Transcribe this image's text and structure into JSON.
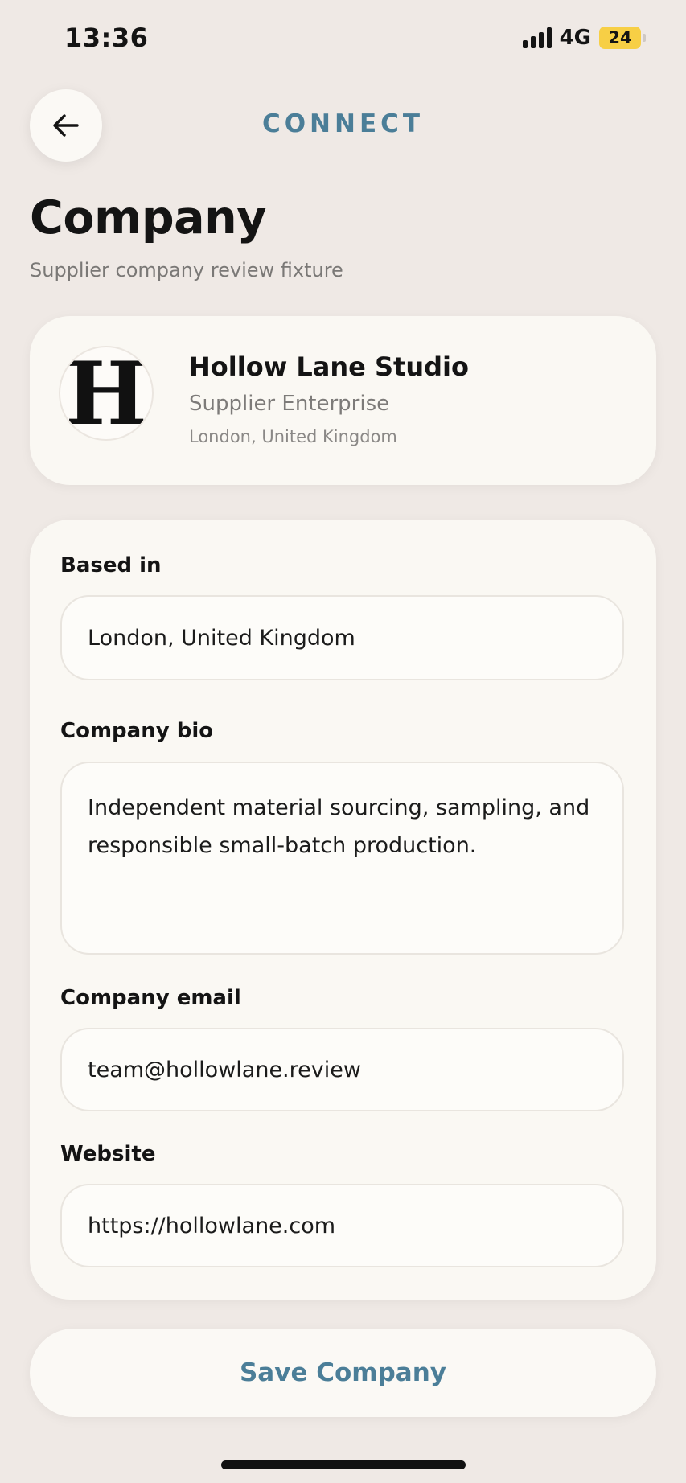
{
  "status_bar": {
    "time": "13:36",
    "network": "4G",
    "battery": "24",
    "battery_color": "#f7cf45"
  },
  "header": {
    "back_icon": "arrow-left-icon",
    "brand": "CONNECT",
    "brand_color": "#4b7e98"
  },
  "page": {
    "title": "Company",
    "subtitle": "Supplier company review fixture"
  },
  "company": {
    "logo_letter": "H",
    "name": "Hollow Lane Studio",
    "type": "Supplier Enterprise",
    "location": "London, United Kingdom"
  },
  "form": {
    "based_in": {
      "label": "Based in",
      "value": "London, United Kingdom"
    },
    "bio": {
      "label": "Company bio",
      "value": "Independent material sourcing, sampling, and responsible small-batch production."
    },
    "email": {
      "label": "Company email",
      "value": "team@hollowlane.review"
    },
    "website": {
      "label": "Website",
      "value": "https://hollowlane.com"
    }
  },
  "actions": {
    "save_label": "Save Company"
  }
}
